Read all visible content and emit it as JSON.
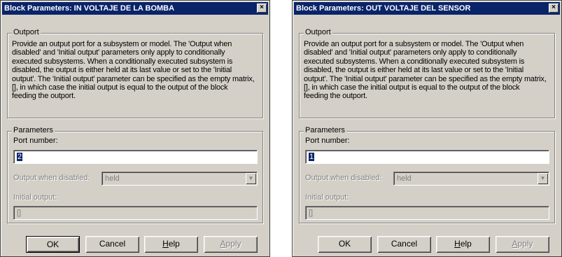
{
  "dialogs": [
    {
      "title": "Block Parameters: IN VOLTAJE DE LA BOMBA",
      "close_glyph": "×",
      "outport_legend": "Outport",
      "description_lines": [
        "Provide an output port for a subsystem or model.  The 'Output when",
        "disabled' and 'Initial output' parameters only apply to conditionally",
        "executed subsystems. When a conditionally executed subsystem is",
        "disabled, the output is either held at its last value or set to the 'Initial",
        "output'. The 'Initial output' parameter can be specified as the empty matrix,",
        "[], in which case the initial output is equal to the output of the block",
        "feeding the outport."
      ],
      "parameters_legend": "Parameters",
      "port_number_label": "Port number:",
      "port_number_value": "2",
      "output_disabled_label": "Output when disabled:",
      "output_disabled_value": "held",
      "initial_output_label": "Initial output:",
      "initial_output_value": "[]",
      "buttons": {
        "ok": "OK",
        "cancel": "Cancel",
        "help_prefix": "",
        "help_mnemonic": "H",
        "help_rest": "elp",
        "apply_prefix": "",
        "apply_mnemonic": "A",
        "apply_rest": "pply"
      }
    },
    {
      "title": "Block Parameters: OUT VOLTAJE DEL SENSOR",
      "close_glyph": "×",
      "outport_legend": "Outport",
      "description_lines": [
        "Provide an output port for a subsystem or model.  The 'Output when",
        "disabled' and 'Initial output' parameters only apply to conditionally",
        "executed subsystems. When a conditionally executed subsystem is",
        "disabled, the output is either held at its last value or set to the 'Initial",
        "output'. The 'Initial output' parameter can be specified as the empty matrix,",
        "[], in which case the initial output is equal to the output of the block",
        "feeding the outport."
      ],
      "parameters_legend": "Parameters",
      "port_number_label": "Port number:",
      "port_number_value": "1",
      "output_disabled_label": "Output when disabled:",
      "output_disabled_value": "held",
      "initial_output_label": "Initial output:",
      "initial_output_value": "[]",
      "buttons": {
        "ok": "OK",
        "cancel": "Cancel",
        "help_prefix": "",
        "help_mnemonic": "H",
        "help_rest": "elp",
        "apply_prefix": "",
        "apply_mnemonic": "A",
        "apply_rest": "pply"
      }
    }
  ],
  "icons": {
    "close": "close-icon",
    "combo_arrow": "chevron-down-icon"
  },
  "colors": {
    "titlebar": "#0a246a",
    "face": "#d4d0c8",
    "disabled_text": "#808080"
  }
}
